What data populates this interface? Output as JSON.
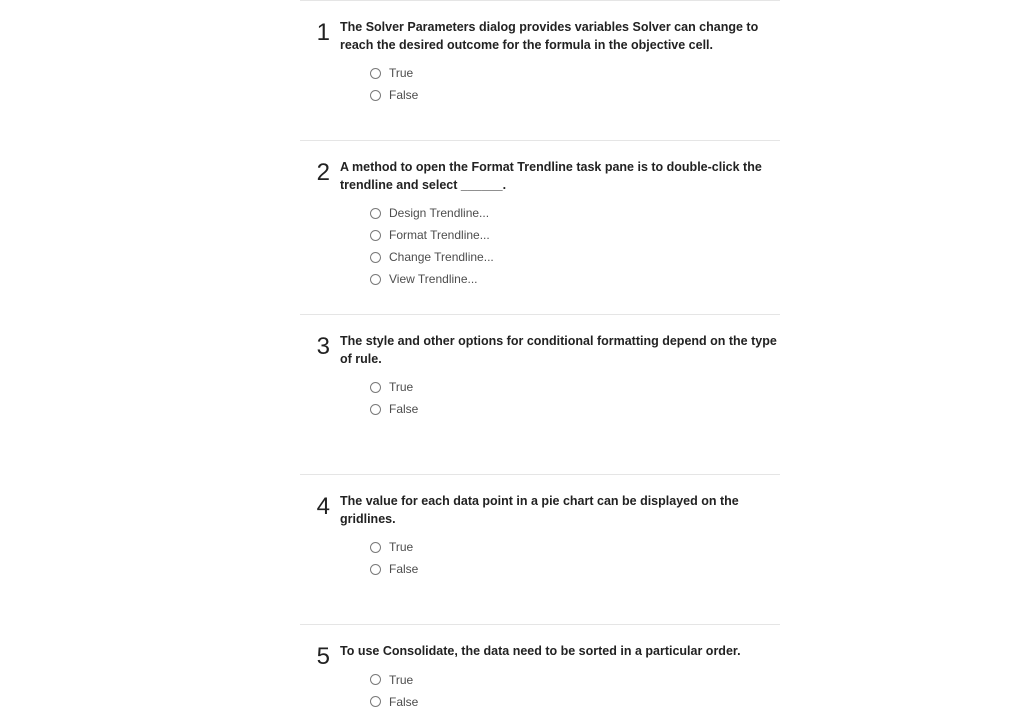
{
  "questions": [
    {
      "number": "1",
      "prompt": "The Solver Parameters dialog provides variables Solver can change to reach the desired outcome for the formula in the objective cell.",
      "options": [
        "True",
        "False"
      ]
    },
    {
      "number": "2",
      "prompt": "A method to open the Format Trendline task pane is to double-click the trendline and select ______.",
      "options": [
        "Design Trendline...",
        "Format Trendline...",
        "Change Trendline...",
        "View Trendline..."
      ]
    },
    {
      "number": "3",
      "prompt": "The style and other options for conditional formatting depend on the type of rule.",
      "options": [
        "True",
        "False"
      ]
    },
    {
      "number": "4",
      "prompt": "The value for each data point in a pie chart can be displayed on the gridlines.",
      "options": [
        "True",
        "False"
      ]
    },
    {
      "number": "5",
      "prompt": "To use Consolidate, the data need to be sorted in a particular order.",
      "options": [
        "True",
        "False"
      ]
    }
  ]
}
